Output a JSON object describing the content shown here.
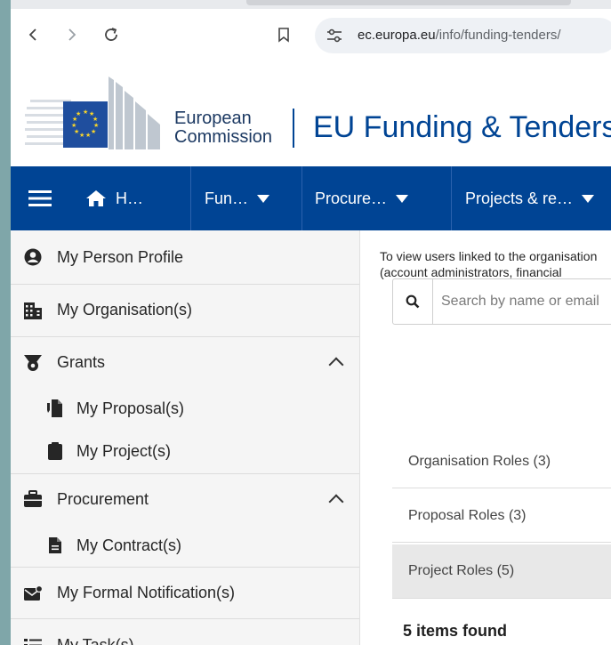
{
  "browser": {
    "url_domain": "ec.europa.eu",
    "url_path": "/info/funding-tenders/"
  },
  "header": {
    "org_line1": "European",
    "org_line2": "Commission",
    "site_title": "EU Funding & Tenders Portal"
  },
  "nav": {
    "items": [
      {
        "label": "H…"
      },
      {
        "label": "Fun…"
      },
      {
        "label": "Procure…"
      },
      {
        "label": "Projects & re…"
      }
    ]
  },
  "sidebar": {
    "items": [
      {
        "label": "My Person Profile",
        "icon": "user-circle-icon"
      },
      {
        "label": "My Organisation(s)",
        "icon": "building-icon"
      },
      {
        "label": "Grants",
        "icon": "grants-icon"
      },
      {
        "label": "My Proposal(s)",
        "icon": "proposal-icon"
      },
      {
        "label": "My Project(s)",
        "icon": "clipboard-icon"
      },
      {
        "label": "Procurement",
        "icon": "briefcase-icon"
      },
      {
        "label": "My Contract(s)",
        "icon": "file-icon"
      },
      {
        "label": "My Formal Notification(s)",
        "icon": "envelope-icon"
      },
      {
        "label": "My Task(s)",
        "icon": "task-list-icon"
      }
    ]
  },
  "main": {
    "intro_line1": "To view users linked to the organisation",
    "intro_line2": "(account administrators, financial",
    "search_placeholder": "Search by name or email",
    "role_tabs": [
      {
        "label": "Organisation Roles (3)"
      },
      {
        "label": "Proposal Roles (3)"
      },
      {
        "label": "Project Roles (5)"
      }
    ],
    "items_found": "5 items found"
  },
  "colors": {
    "brand_blue": "#004494",
    "sidebar_bg": "#f5f5f5",
    "active_tab_bg": "#e8e8e8"
  }
}
